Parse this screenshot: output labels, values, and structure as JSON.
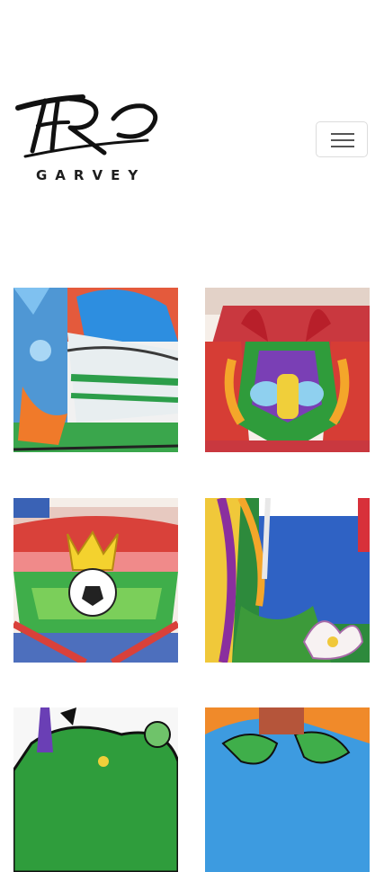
{
  "header": {
    "logo_mark": "FERO",
    "logo_subtitle": "GARVEY",
    "menu_icon": "hamburger-icon"
  },
  "gallery": {
    "items": [
      {
        "subject": "sneaker-and-bird"
      },
      {
        "subject": "dragon-mask"
      },
      {
        "subject": "stadium-crown-ball"
      },
      {
        "subject": "flag-and-flower"
      },
      {
        "subject": "cactus-character"
      },
      {
        "subject": "green-blob-art"
      }
    ]
  }
}
